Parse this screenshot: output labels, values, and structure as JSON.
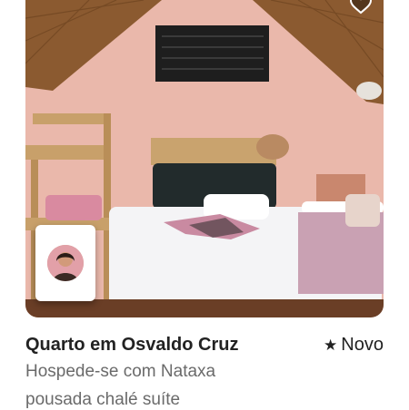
{
  "listing": {
    "title": "Quarto em Osvaldo Cruz",
    "badge_label": "Novo",
    "host_line": "Hospede-se com Nataxa",
    "description": "pousada chalé suíte"
  },
  "icons": {
    "wishlist": "heart-icon",
    "rating": "star-icon"
  },
  "colors": {
    "wall": "#e9b9ad",
    "ceiling_wood": "#8a5a32",
    "text_primary": "#222222",
    "text_secondary": "#6a6a6a"
  }
}
